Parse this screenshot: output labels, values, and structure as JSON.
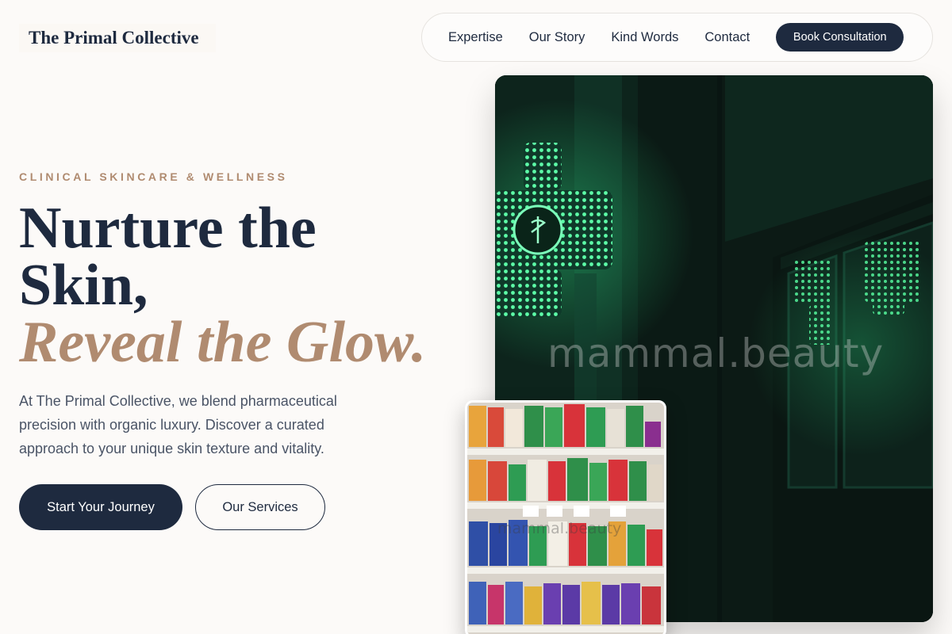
{
  "brand": {
    "name": "The Primal Collective"
  },
  "nav": {
    "links": [
      "Expertise",
      "Our Story",
      "Kind Words",
      "Contact"
    ],
    "cta": "Book Consultation"
  },
  "hero": {
    "eyebrow": "CLINICAL SKINCARE & WELLNESS",
    "headline_line1": "Nurture the",
    "headline_line2": "Skin,",
    "headline_accent": "Reveal the Glow.",
    "lede": "At The Primal Collective, we blend pharmaceutical precision with organic luxury. Discover a curated approach to your unique skin texture and vitality.",
    "primary_button": "Start Your Journey",
    "secondary_button": "Our Services"
  },
  "images": {
    "main_alt": "Green pharmacy cross sign at night",
    "main_watermark": "mammal.beauty",
    "inset_alt": "Pharmacy shelves with medicine boxes",
    "inset_watermark": "mammal.beauty"
  },
  "colors": {
    "navy": "#1e2a3f",
    "accent": "#b08b70",
    "background": "#fcfaf8",
    "neon_green": "#3dff9a"
  }
}
